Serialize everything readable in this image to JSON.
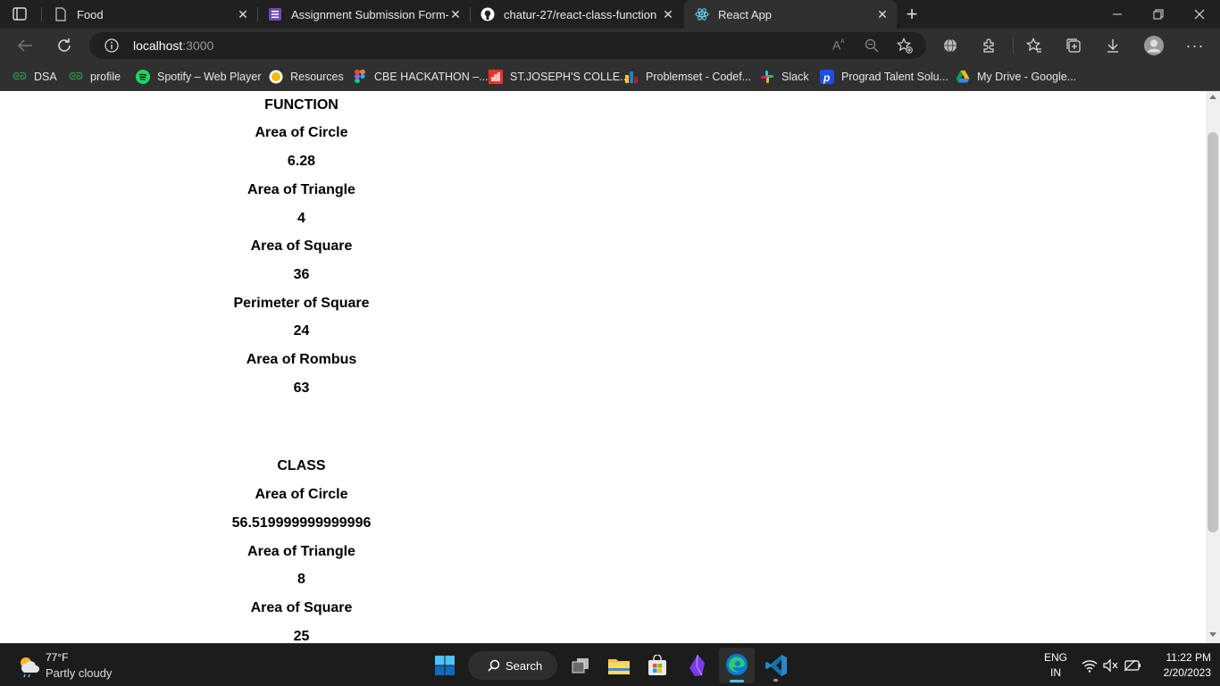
{
  "tabs": [
    {
      "label": "Food"
    },
    {
      "label": "Assignment Submission Form-Re"
    },
    {
      "label": "chatur-27/react-class-function"
    },
    {
      "label": "React App"
    }
  ],
  "address": {
    "host": "localhost",
    "port": ":3000"
  },
  "bookmarks": [
    {
      "label": "DSA"
    },
    {
      "label": "profile"
    },
    {
      "label": "Spotify – Web Player"
    },
    {
      "label": "Resources"
    },
    {
      "label": "CBE HACKATHON –..."
    },
    {
      "label": "ST.JOSEPH'S COLLE..."
    },
    {
      "label": "Problemset - Codef..."
    },
    {
      "label": "Slack"
    },
    {
      "label": "Prograd Talent Solu..."
    },
    {
      "label": "My Drive - Google..."
    }
  ],
  "page": {
    "function_section": {
      "heading": "FUNCTION",
      "items": [
        {
          "label": "Area of Circle",
          "value": "6.28"
        },
        {
          "label": "Area of Triangle",
          "value": "4"
        },
        {
          "label": "Area of Square",
          "value": "36"
        },
        {
          "label": "Perimeter of Square",
          "value": "24"
        },
        {
          "label": "Area of Rombus",
          "value": "63"
        }
      ]
    },
    "class_section": {
      "heading": "CLASS",
      "items": [
        {
          "label": "Area of Circle",
          "value": "56.519999999999996"
        },
        {
          "label": "Area of Triangle",
          "value": "8"
        },
        {
          "label": "Area of Square",
          "value": "25"
        }
      ]
    }
  },
  "taskbar": {
    "weather": {
      "temp": "77°F",
      "condition": "Partly cloudy"
    },
    "search_label": "Search",
    "lang": {
      "line1": "ENG",
      "line2": "IN"
    },
    "clock": {
      "time": "11:22 PM",
      "date": "2/20/2023"
    }
  }
}
